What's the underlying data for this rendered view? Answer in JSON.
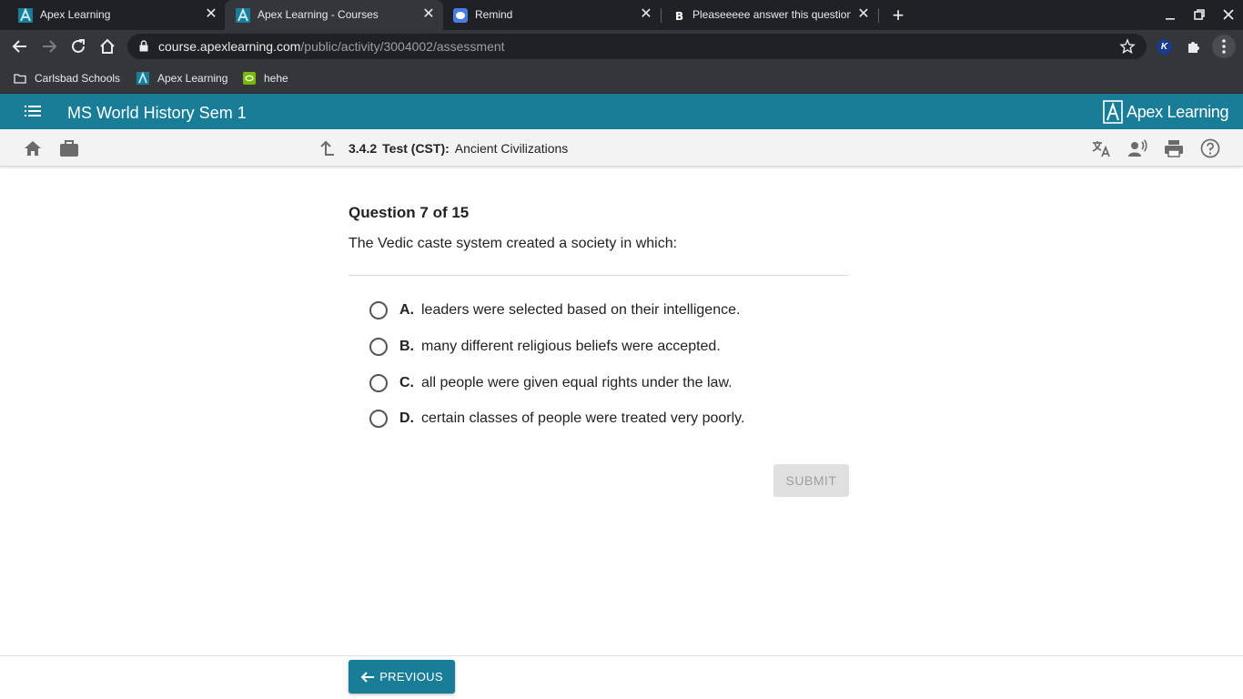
{
  "browser": {
    "tabs": [
      {
        "title": "Apex Learning",
        "active": false
      },
      {
        "title": "Apex Learning - Courses",
        "active": true
      },
      {
        "title": "Remind",
        "active": false
      },
      {
        "title": "Pleaseeeee answer this question",
        "active": false
      }
    ],
    "url_host": "course.apexlearning.com",
    "url_path": "/public/activity/3004002/assessment",
    "bookmarks": [
      "Carlsbad Schools",
      "Apex Learning",
      "hehe"
    ],
    "extension_badge": "K"
  },
  "app": {
    "course_title": "MS World History Sem 1",
    "brand": "Apex Learning",
    "accent_color": "#1a7d98"
  },
  "breadcrumb": {
    "number": "3.4.2",
    "kind": "Test (CST):",
    "name": "Ancient Civilizations"
  },
  "question": {
    "header": "Question 7 of 15",
    "prompt": "The Vedic caste system created a society in which:",
    "choices": [
      {
        "letter": "A.",
        "text": "leaders were selected based on their intelligence."
      },
      {
        "letter": "B.",
        "text": "many different religious beliefs were accepted."
      },
      {
        "letter": "C.",
        "text": "all people were given equal rights under the law."
      },
      {
        "letter": "D.",
        "text": "certain classes of people were treated very poorly."
      }
    ]
  },
  "buttons": {
    "submit": "SUBMIT",
    "previous": "PREVIOUS"
  }
}
